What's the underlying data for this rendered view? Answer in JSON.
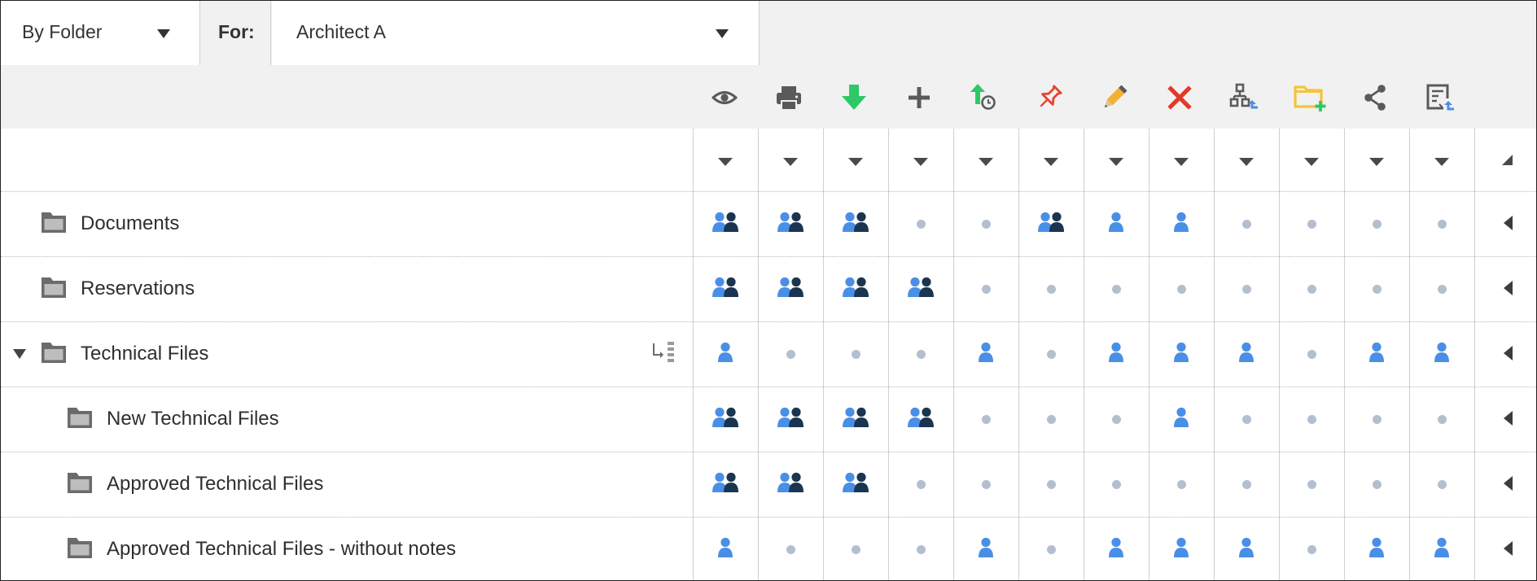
{
  "filters": {
    "view_mode": "By Folder",
    "for_label": "For:",
    "user": "Architect A"
  },
  "toolbar": {
    "icons": [
      "eye-icon",
      "print-icon",
      "download-icon",
      "add-icon",
      "upload-version-icon",
      "pin-icon",
      "edit-icon",
      "delete-icon",
      "workflow-icon",
      "new-folder-icon",
      "share-icon",
      "revision-icon"
    ]
  },
  "colors": {
    "user_blue": "#4a8fe6",
    "group_dark": "#1b3550",
    "none_dot": "#b3bfcf",
    "download_green": "#2ec866",
    "pin_red": "#e8432e",
    "delete_red": "#e03a2c",
    "edit_yellow": "#f2b134",
    "folder_yellow": "#f5c33b"
  },
  "legend": {
    "G": "user-and-group-permission-icon",
    "U": "user-permission-icon",
    "N": "no-permission-dot"
  },
  "rows": [
    {
      "name": "Documents",
      "indent": 0,
      "expandable": false,
      "inherit_toggle": false,
      "perms": [
        "G",
        "G",
        "G",
        "N",
        "N",
        "G",
        "U",
        "U",
        "N",
        "N",
        "N",
        "N"
      ]
    },
    {
      "name": "Reservations",
      "indent": 0,
      "expandable": false,
      "inherit_toggle": false,
      "perms": [
        "G",
        "G",
        "G",
        "G",
        "N",
        "N",
        "N",
        "N",
        "N",
        "N",
        "N",
        "N"
      ]
    },
    {
      "name": "Technical Files",
      "indent": 0,
      "expandable": true,
      "inherit_toggle": true,
      "perms": [
        "U",
        "N",
        "N",
        "N",
        "U",
        "N",
        "U",
        "U",
        "U",
        "N",
        "U",
        "U"
      ]
    },
    {
      "name": "New Technical Files",
      "indent": 1,
      "expandable": false,
      "inherit_toggle": false,
      "perms": [
        "G",
        "G",
        "G",
        "G",
        "N",
        "N",
        "N",
        "U",
        "N",
        "N",
        "N",
        "N"
      ]
    },
    {
      "name": "Approved Technical Files",
      "indent": 1,
      "expandable": false,
      "inherit_toggle": false,
      "perms": [
        "G",
        "G",
        "G",
        "N",
        "N",
        "N",
        "N",
        "N",
        "N",
        "N",
        "N",
        "N"
      ]
    },
    {
      "name": "Approved Technical Files - without notes",
      "indent": 1,
      "expandable": false,
      "inherit_toggle": false,
      "perms": [
        "U",
        "N",
        "N",
        "N",
        "U",
        "N",
        "U",
        "U",
        "U",
        "N",
        "U",
        "U"
      ]
    }
  ]
}
